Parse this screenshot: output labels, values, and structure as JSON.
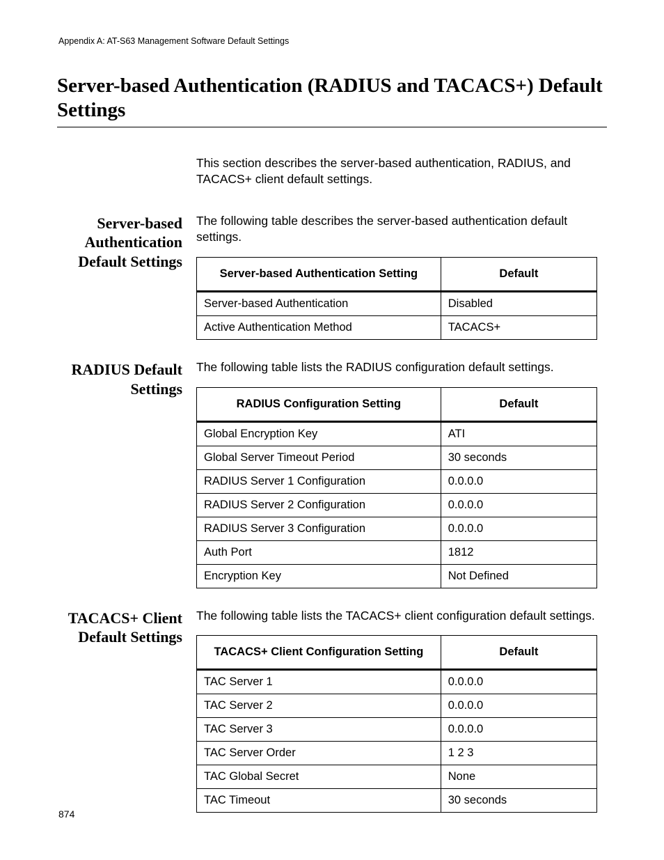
{
  "running_head": "Appendix A: AT-S63 Management Software Default Settings",
  "title": "Server-based Authentication (RADIUS and TACACS+) Default Settings",
  "intro": "This section describes the server-based authentication, RADIUS, and TACACS+ client default settings.",
  "sections": [
    {
      "heading": "Server-based Authentication Default Settings",
      "intro": "The following table describes the server-based authentication default settings.",
      "columns": [
        "Server-based Authentication Setting",
        "Default"
      ],
      "rows": [
        [
          "Server-based Authentication",
          "Disabled"
        ],
        [
          "Active Authentication Method",
          "TACACS+"
        ]
      ]
    },
    {
      "heading": "RADIUS Default Settings",
      "intro": "The following table lists the RADIUS configuration default settings.",
      "columns": [
        "RADIUS Configuration Setting",
        "Default"
      ],
      "rows": [
        [
          "Global Encryption Key",
          "ATI"
        ],
        [
          "Global Server Timeout Period",
          "30 seconds"
        ],
        [
          "RADIUS Server 1 Configuration",
          "0.0.0.0"
        ],
        [
          "RADIUS Server 2 Configuration",
          "0.0.0.0"
        ],
        [
          "RADIUS Server 3 Configuration",
          "0.0.0.0"
        ],
        [
          "Auth Port",
          "1812"
        ],
        [
          "Encryption Key",
          "Not Defined"
        ]
      ]
    },
    {
      "heading": "TACACS+ Client Default Settings",
      "intro": "The following table lists the TACACS+ client configuration default settings.",
      "columns": [
        "TACACS+ Client Configuration Setting",
        "Default"
      ],
      "rows": [
        [
          "TAC Server 1",
          "0.0.0.0"
        ],
        [
          "TAC Server 2",
          "0.0.0.0"
        ],
        [
          "TAC Server 3",
          "0.0.0.0"
        ],
        [
          "TAC Server Order",
          "1 2 3"
        ],
        [
          "TAC Global Secret",
          "None"
        ],
        [
          "TAC Timeout",
          "30 seconds"
        ]
      ]
    }
  ],
  "page_number": "874"
}
